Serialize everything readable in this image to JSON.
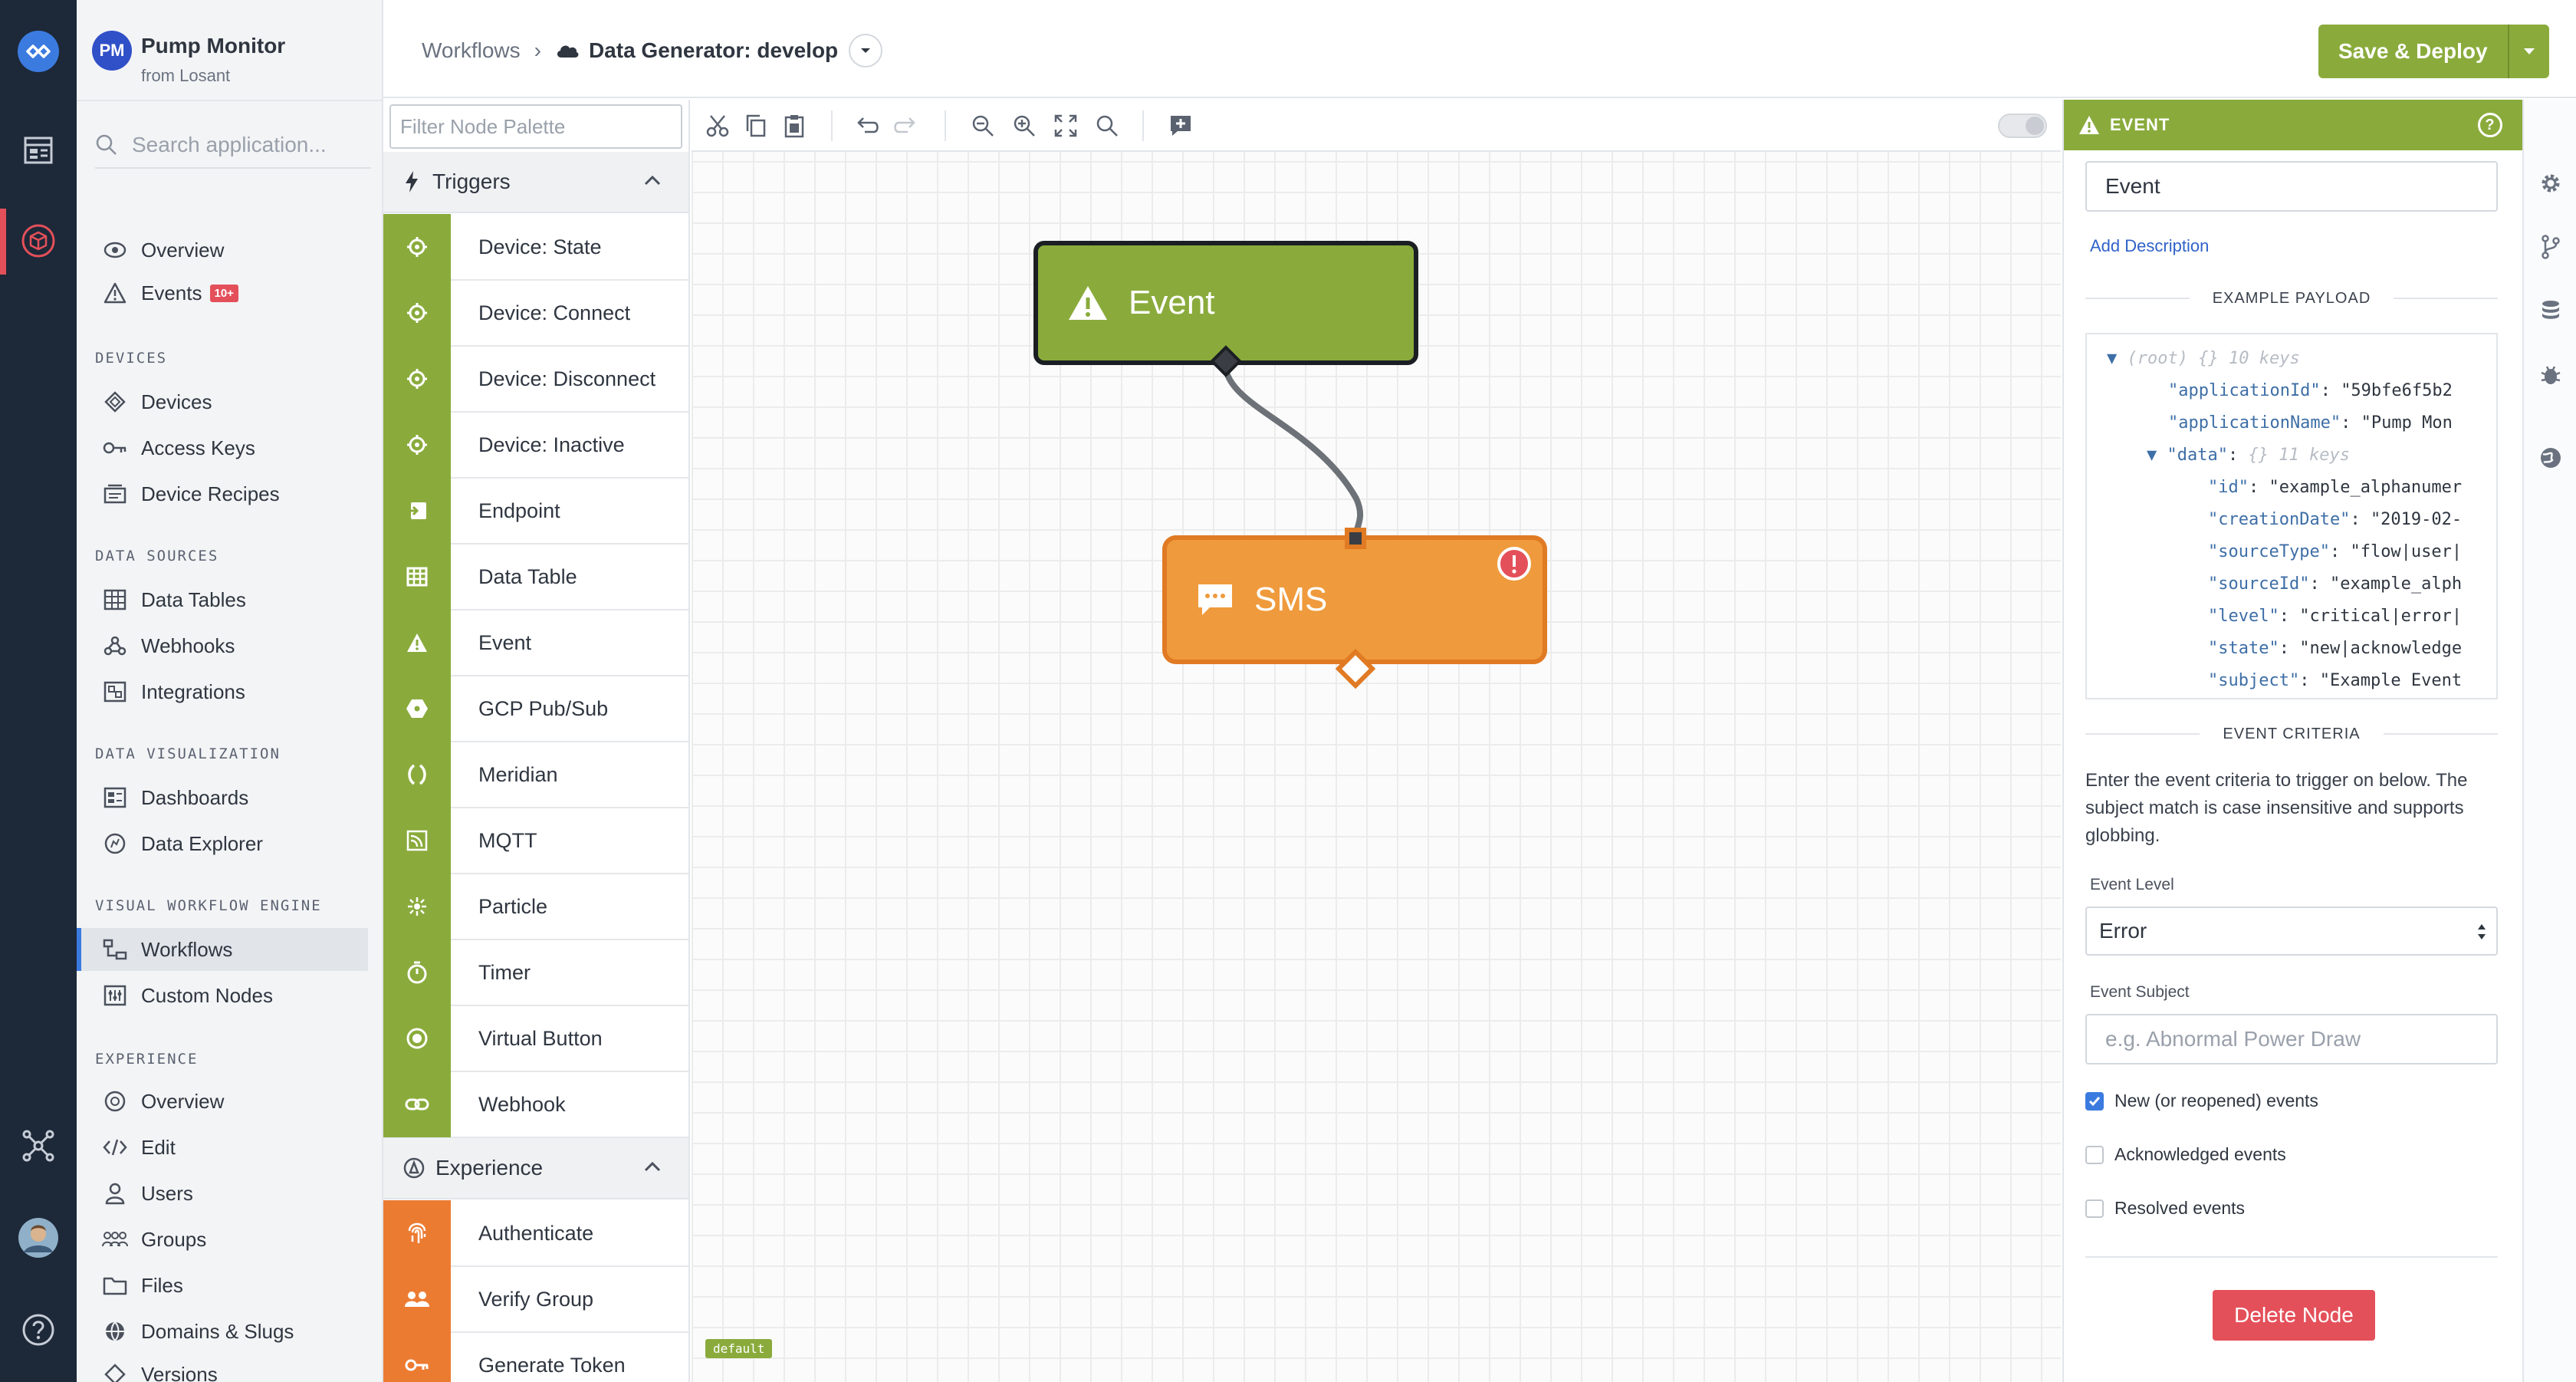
{
  "rail": {
    "icons": [
      "losant-logo-icon",
      "dashboard-icon",
      "application-cube-icon",
      "network-icon",
      "user-avatar",
      "help-icon"
    ]
  },
  "app": {
    "avatar": "PM",
    "name": "Pump Monitor",
    "org": "from Losant"
  },
  "sidebar": {
    "search_placeholder": "Search application...",
    "top": [
      {
        "label": "Overview",
        "icon": "eye-icon"
      },
      {
        "label": "Events",
        "icon": "warning-icon",
        "badge": "10+"
      }
    ],
    "sections": [
      {
        "title": "DEVICES",
        "items": [
          {
            "label": "Devices",
            "icon": "diamond-icon"
          },
          {
            "label": "Access Keys",
            "icon": "key-icon"
          },
          {
            "label": "Device Recipes",
            "icon": "recipe-icon"
          }
        ]
      },
      {
        "title": "DATA SOURCES",
        "items": [
          {
            "label": "Data Tables",
            "icon": "table-icon"
          },
          {
            "label": "Webhooks",
            "icon": "webhook-icon"
          },
          {
            "label": "Integrations",
            "icon": "integration-icon"
          }
        ]
      },
      {
        "title": "DATA VISUALIZATION",
        "items": [
          {
            "label": "Dashboards",
            "icon": "dashboard-icon"
          },
          {
            "label": "Data Explorer",
            "icon": "explorer-icon"
          }
        ]
      },
      {
        "title": "VISUAL WORKFLOW ENGINE",
        "items": [
          {
            "label": "Workflows",
            "icon": "workflow-icon",
            "active": true
          },
          {
            "label": "Custom Nodes",
            "icon": "custom-nodes-icon"
          }
        ]
      },
      {
        "title": "EXPERIENCE",
        "items": [
          {
            "label": "Overview",
            "icon": "eye-icon"
          },
          {
            "label": "Edit",
            "icon": "code-icon"
          },
          {
            "label": "Users",
            "icon": "user-icon"
          },
          {
            "label": "Groups",
            "icon": "groups-icon"
          },
          {
            "label": "Files",
            "icon": "folder-icon"
          },
          {
            "label": "Domains & Slugs",
            "icon": "globe-icon"
          },
          {
            "label": "Versions",
            "icon": "diamond-icon"
          }
        ]
      }
    ]
  },
  "header": {
    "breadcrumb_root": "Workflows",
    "breadcrumb_sep": "›",
    "workflow_name": "Data Generator: develop",
    "deploy_label": "Save & Deploy"
  },
  "palette": {
    "filter_placeholder": "Filter Node Palette",
    "groups": [
      {
        "title": "Triggers",
        "color": "#8aab3c",
        "nodes": [
          "Device: State",
          "Device: Connect",
          "Device: Disconnect",
          "Device: Inactive",
          "Endpoint",
          "Data Table",
          "Event",
          "GCP Pub/Sub",
          "Meridian",
          "MQTT",
          "Particle",
          "Timer",
          "Virtual Button",
          "Webhook"
        ]
      },
      {
        "title": "Experience",
        "color": "#ec7b32",
        "nodes": [
          "Authenticate",
          "Verify Group",
          "Generate Token"
        ]
      }
    ]
  },
  "canvas": {
    "nodes": [
      {
        "label": "Event",
        "type": "trigger",
        "color": "#8aab3c"
      },
      {
        "label": "SMS",
        "type": "output",
        "color": "#ef9a3c",
        "error": true
      }
    ],
    "env_tag": "default"
  },
  "panel": {
    "title": "EVENT",
    "node_name": "Event",
    "add_description": "Add Description",
    "payload_title": "EXAMPLE PAYLOAD",
    "payload_lines": [
      {
        "indent": 0,
        "arrow": true,
        "key": "(root)",
        "meta": "{} 10 keys"
      },
      {
        "indent": 1,
        "key": "\"applicationId\"",
        "value": "\"59bfe6f5b2"
      },
      {
        "indent": 1,
        "key": "\"applicationName\"",
        "value": "\"Pump Mon"
      },
      {
        "indent": 1,
        "arrow": true,
        "key": "\"data\"",
        "meta": "{} 11 keys"
      },
      {
        "indent": 2,
        "key": "\"id\"",
        "value": "\"example_alphanumer"
      },
      {
        "indent": 2,
        "key": "\"creationDate\"",
        "value": "\"2019-02-"
      },
      {
        "indent": 2,
        "key": "\"sourceType\"",
        "value": "\"flow|user|"
      },
      {
        "indent": 2,
        "key": "\"sourceId\"",
        "value": "\"example_alph"
      },
      {
        "indent": 2,
        "key": "\"level\"",
        "value": "\"critical|error|"
      },
      {
        "indent": 2,
        "key": "\"state\"",
        "value": "\"new|acknowledge"
      },
      {
        "indent": 2,
        "key": "\"subject\"",
        "value": "\"Example Event"
      }
    ],
    "criteria_title": "EVENT CRITERIA",
    "criteria_text": "Enter the event criteria to trigger on below. The subject match is case insensitive and supports globbing.",
    "level_label": "Event Level",
    "level_value": "Error",
    "subject_label": "Event Subject",
    "subject_placeholder": "e.g. Abnormal Power Draw",
    "checks": [
      {
        "label": "New (or reopened) events",
        "checked": true
      },
      {
        "label": "Acknowledged events",
        "checked": false
      },
      {
        "label": "Resolved events",
        "checked": false
      }
    ],
    "delete_label": "Delete Node"
  },
  "right_strip": {
    "icons": [
      "settings-icon",
      "branch-icon",
      "storage-icon",
      "debug-icon",
      "globe-icon"
    ]
  },
  "colors": {
    "rail": "#1d2838",
    "trigger_green": "#8aab3c",
    "experience_orange": "#ec7b32",
    "danger": "#e4505a",
    "link": "#2f62c8"
  }
}
